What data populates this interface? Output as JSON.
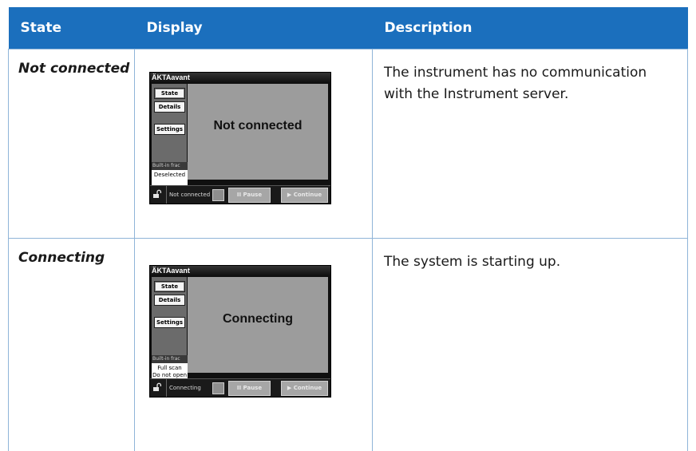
{
  "table": {
    "headers": [
      "State",
      "Display",
      "Description"
    ],
    "rows": [
      {
        "state": "Not connected",
        "description": "The instrument has no communication with the Instrument server.",
        "display": {
          "title": "ÄKTAavant",
          "buttons": [
            "State",
            "Details",
            "Settings"
          ],
          "main_text": "Not connected",
          "frac_label": "Built-in frac",
          "frac_lines": [
            "Deselected"
          ],
          "status_text": "Not connected",
          "pause_label": "II Pause",
          "continue_label": "▶ Continue"
        }
      },
      {
        "state": "Connecting",
        "description": "The system is starting up.",
        "display": {
          "title": "ÄKTAavant",
          "buttons": [
            "State",
            "Details",
            "Settings"
          ],
          "main_text": "Connecting",
          "frac_label": "Built-in frac",
          "frac_lines": [
            "Full scan",
            "Do not open"
          ],
          "status_text": "Connecting",
          "pause_label": "II Pause",
          "continue_label": "▶ Continue"
        }
      }
    ]
  },
  "colors": {
    "header_bg": "#1b6fbd",
    "header_text": "#ffffff",
    "border": "#8fb4d8"
  },
  "icons": {
    "lock": "lock-open-icon"
  }
}
